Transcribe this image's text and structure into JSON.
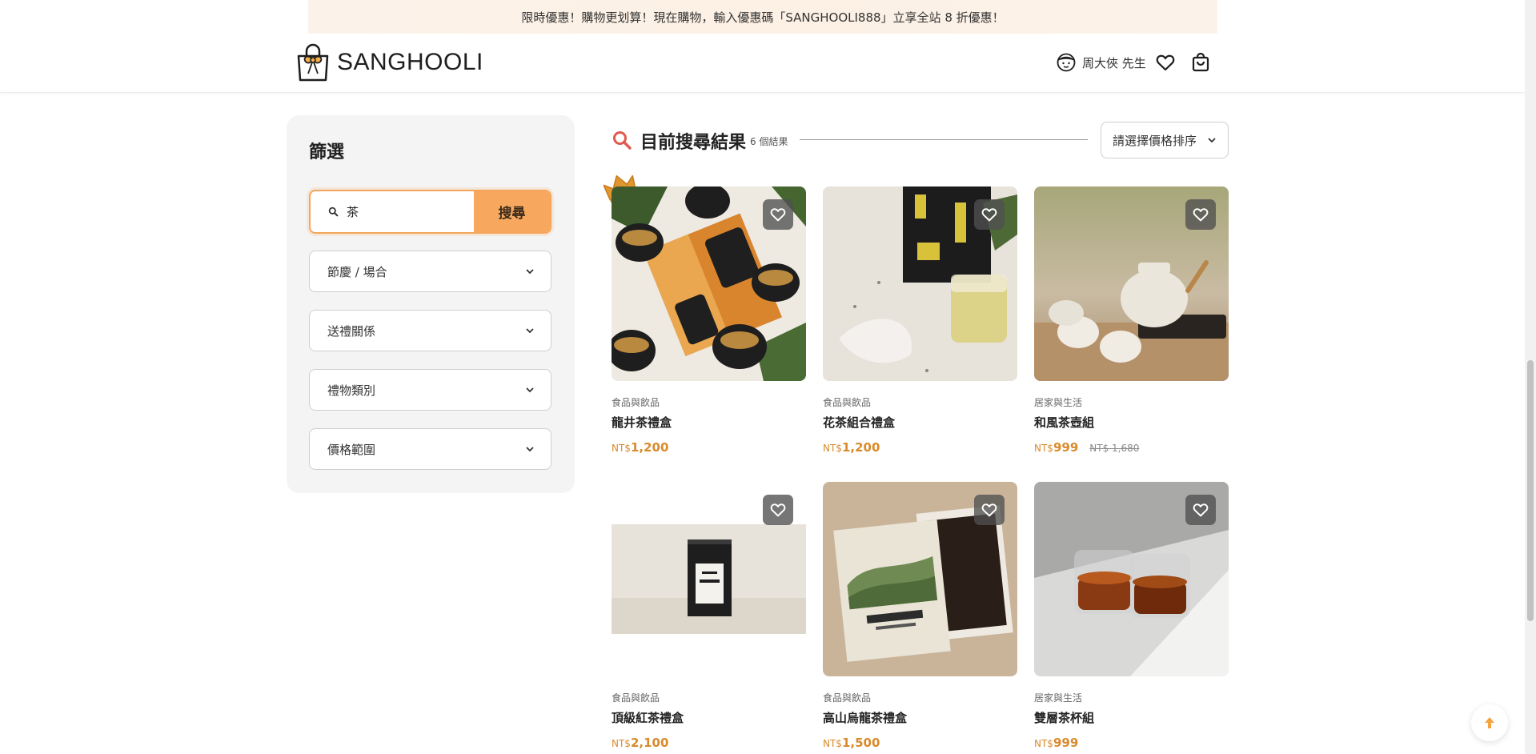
{
  "promo": {
    "text": "限時優惠！購物更划算！現在購物，輸入優惠碼「SANGHOOLI888」立享全站 8 折優惠！"
  },
  "header": {
    "logo_text": "SANGHOOLI",
    "user_name": "周大俠 先生",
    "icons": [
      "user-avatar-icon",
      "heart-icon",
      "shopping-bag-icon"
    ]
  },
  "sidebar": {
    "title": "篩選",
    "search": {
      "value": "茶",
      "button_label": "搜尋"
    },
    "dropdowns": [
      {
        "label": "節慶 / 場合"
      },
      {
        "label": "送禮關係"
      },
      {
        "label": "禮物類別"
      },
      {
        "label": "價格範圍"
      }
    ]
  },
  "results": {
    "title": "目前搜尋結果",
    "count": "6 個結果",
    "sort_label": "請選擇價格排序"
  },
  "products": [
    {
      "category": "食品與飲品",
      "name": "龍井茶禮盒",
      "currency": "NT$",
      "price": "1,200",
      "old_price": "",
      "featured": true
    },
    {
      "category": "食品與飲品",
      "name": "花茶組合禮盒",
      "currency": "NT$",
      "price": "1,200",
      "old_price": ""
    },
    {
      "category": "居家與生活",
      "name": "和風茶壺組",
      "currency": "NT$",
      "price": "999",
      "old_price": "NT$ 1,680"
    },
    {
      "category": "食品與飲品",
      "name": "頂級紅茶禮盒",
      "currency": "NT$",
      "price": "2,100",
      "old_price": ""
    },
    {
      "category": "食品與飲品",
      "name": "高山烏龍茶禮盒",
      "currency": "NT$",
      "price": "1,500",
      "old_price": ""
    },
    {
      "category": "居家與生活",
      "name": "雙層茶杯組",
      "currency": "NT$",
      "price": "999",
      "old_price": ""
    }
  ],
  "colors": {
    "accent": "#f7a85e",
    "price": "#d98a2b",
    "search_icon": "#e05a4f"
  }
}
